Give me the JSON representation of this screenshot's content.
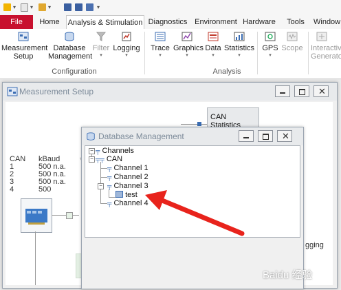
{
  "tabs": {
    "file": "File",
    "home": "Home",
    "analysis": "Analysis & Stimulation",
    "diagnostics": "Diagnostics",
    "environment": "Environment",
    "hardware": "Hardware",
    "tools": "Tools",
    "window": "Window"
  },
  "ribbon": {
    "measurement_setup_l1": "Measurement",
    "measurement_setup_l2": "Setup",
    "database_mgmt_l1": "Database",
    "database_mgmt_l2": "Management",
    "filter": "Filter",
    "logging": "Logging",
    "configuration_group": "Configuration",
    "trace": "Trace",
    "graphics": "Graphics",
    "data": "Data",
    "statistics": "Statistics",
    "analysis_group": "Analysis",
    "gps": "GPS",
    "scope": "Scope",
    "interactive_l1": "Interactiv",
    "interactive_l2": "Generator"
  },
  "measurement_setup": {
    "title": "Measurement Setup",
    "can_statistics": "CAN Statistics",
    "col_can": "CAN",
    "col_kbaud": "kBaud",
    "rows": [
      {
        "ch": "1",
        "val": "500 n.a."
      },
      {
        "ch": "2",
        "val": "500 n.a."
      },
      {
        "ch": "3",
        "val": "500 n.a."
      },
      {
        "ch": "4",
        "val": "500"
      }
    ],
    "logging_partial": "gging"
  },
  "database_management": {
    "title": "Database Management",
    "root": "Channels",
    "can": "CAN",
    "channels": [
      "Channel 1",
      "Channel 2",
      "Channel 3",
      "Channel 4"
    ],
    "db_item": "test"
  },
  "watermark": "Baidu 经验"
}
